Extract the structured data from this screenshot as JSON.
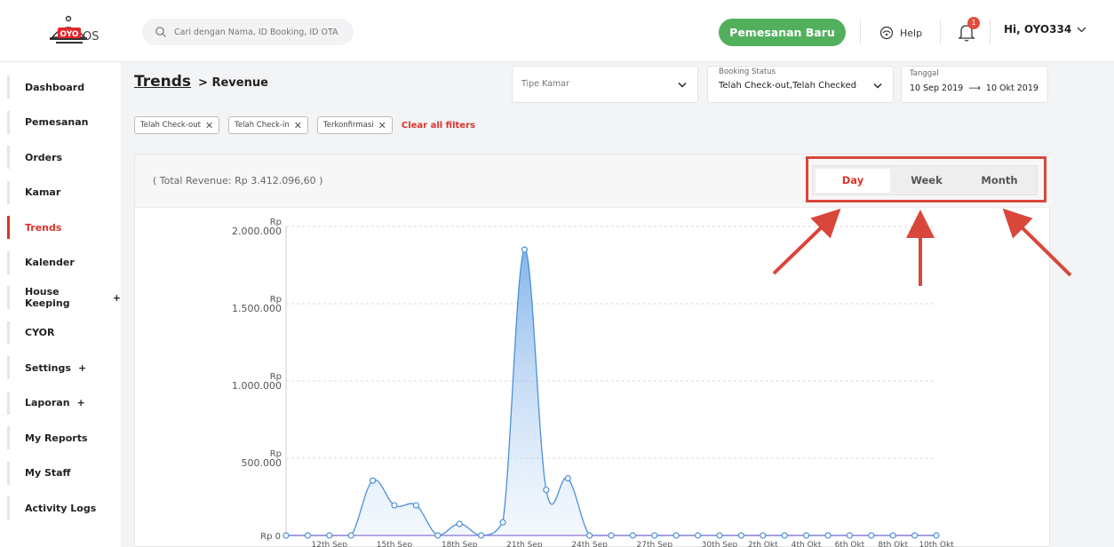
{
  "header": {
    "logo_text": "OYO",
    "logo_suffix": "OS",
    "search_placeholder": "Cari dengan Nama, ID Booking, ID OTA",
    "new_booking_label": "Pemesanan Baru",
    "help_label": "Help",
    "notification_count": "1",
    "user_label": "Hi, OYO334"
  },
  "sidebar": {
    "items": [
      {
        "label": "Dashboard",
        "active": false
      },
      {
        "label": "Pemesanan",
        "active": false
      },
      {
        "label": "Orders",
        "active": false
      },
      {
        "label": "Kamar",
        "active": false
      },
      {
        "label": "Trends",
        "active": true
      },
      {
        "label": "Kalender",
        "active": false
      },
      {
        "label": "House Keeping",
        "active": false,
        "expand": "+"
      },
      {
        "label": "CYOR",
        "active": false
      },
      {
        "label": "Settings",
        "active": false,
        "expand": "+"
      },
      {
        "label": "Laporan",
        "active": false,
        "expand": "+"
      },
      {
        "label": "My Reports",
        "active": false
      },
      {
        "label": "My Staff",
        "active": false
      },
      {
        "label": "Activity Logs",
        "active": false
      }
    ]
  },
  "page": {
    "breadcrumb_link": "Trends",
    "breadcrumb_current": "> Revenue"
  },
  "filters": {
    "room_type_placeholder": "Tipe Kamar",
    "booking_status_label": "Booking Status",
    "booking_status_value": "Telah Check-out,Telah Checked-in",
    "date_label": "Tanggal",
    "date_from": "10 Sep 2019",
    "date_arrow": "⟶",
    "date_to": "10 Okt 2019",
    "chips": [
      "Telah Check-out",
      "Telah Check-in",
      "Terkonfirmasi"
    ],
    "clear_label": "Clear all filters"
  },
  "card": {
    "total_text": "( Total Revenue: Rp 3.412.096,60 )",
    "toggle": [
      "Day",
      "Week",
      "Month"
    ],
    "active_toggle": "Day"
  },
  "colors": {
    "accent": "#d9342b",
    "brand_green": "#52b05d",
    "line_blue": "#4a90d9",
    "baseline_purple": "#8a74d6"
  },
  "chart_data": {
    "type": "area",
    "x": [
      "10th Sep",
      "11th Sep",
      "12th Sep",
      "13th Sep",
      "14th Sep",
      "15th Sep",
      "16th Sep",
      "17th Sep",
      "18th Sep",
      "19th Sep",
      "20th Sep",
      "21th Sep",
      "22th Sep",
      "23th Sep",
      "24th Sep",
      "25th Sep",
      "26th Sep",
      "27th Sep",
      "28th Sep",
      "29th Sep",
      "30th Sep",
      "1th Okt",
      "2th Okt",
      "3th Okt",
      "4th Okt",
      "5th Okt",
      "6th Okt",
      "7th Okt",
      "8th Okt",
      "9th Okt",
      "10th Okt"
    ],
    "series": [
      {
        "values": [
          0,
          0,
          0,
          0,
          355000,
          195000,
          195000,
          0,
          75000,
          0,
          85000,
          1850000,
          295000,
          370000,
          0,
          0,
          0,
          0,
          0,
          0,
          0,
          0,
          0,
          0,
          0,
          0,
          0,
          0,
          0,
          0,
          0
        ]
      },
      {
        "values": [
          0,
          0,
          0,
          0,
          0,
          0,
          0,
          0,
          0,
          0,
          0,
          0,
          0,
          0,
          0,
          0,
          0,
          0,
          0,
          0,
          0,
          0,
          0,
          0,
          0,
          0,
          0,
          0,
          0,
          0,
          0
        ]
      }
    ],
    "tick_labels": [
      "12th Sep",
      "15th Sep",
      "18th Sep",
      "21th Sep",
      "24th Sep",
      "27th Sep",
      "30th Sep",
      "2th Okt",
      "4th Okt",
      "6th Okt",
      "8th Okt",
      "10th Okt"
    ],
    "y_ticks": [
      {
        "value": 0,
        "label": "Rp 0"
      },
      {
        "value": 500000,
        "label_top": "Rp",
        "label_bottom": "500.000"
      },
      {
        "value": 1000000,
        "label_top": "Rp",
        "label_bottom": "1.000.000"
      },
      {
        "value": 1500000,
        "label_top": "Rp",
        "label_bottom": "1.500.000"
      },
      {
        "value": 2000000,
        "label_top": "Rp",
        "label_bottom": "2.000.000"
      }
    ],
    "ylim": [
      0,
      2000000
    ],
    "grid": true
  }
}
